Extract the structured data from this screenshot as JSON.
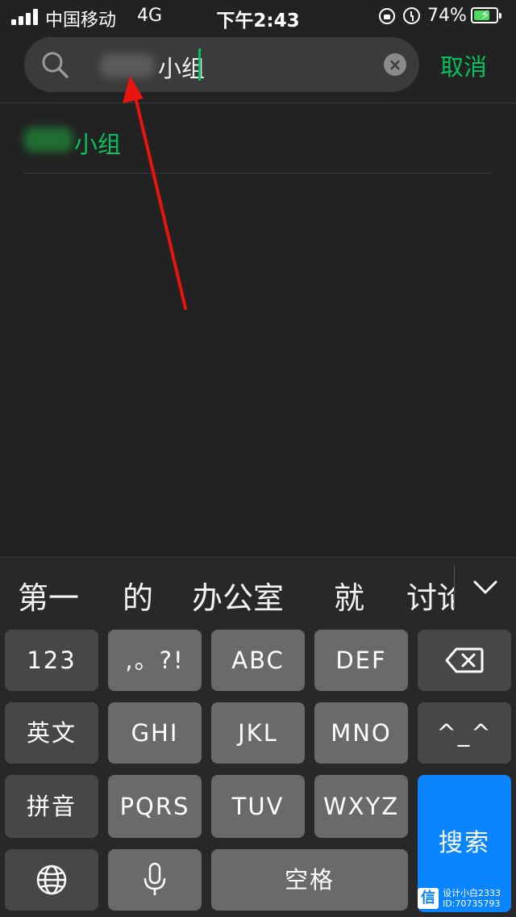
{
  "status_bar": {
    "carrier": "中国移动",
    "network": "4G",
    "time": "下午2:43",
    "battery_percent": "74%",
    "battery_level": 0.74,
    "icons": [
      "signal-icon",
      "orientation-lock-icon",
      "alarm-icon",
      "battery-charging-icon"
    ]
  },
  "search": {
    "query_visible": "小组",
    "cancel_label": "取消",
    "icons": [
      "search-icon",
      "clear-icon"
    ]
  },
  "results": [
    {
      "label": "小组"
    }
  ],
  "keyboard": {
    "candidates": [
      "第一",
      "的",
      "办公室",
      "就",
      "讨论"
    ],
    "rows": [
      [
        "123",
        ",。?!",
        "ABC",
        "DEF",
        "delete-icon"
      ],
      [
        "英文",
        "GHI",
        "JKL",
        "MNO",
        "^_^"
      ],
      [
        "拼音",
        "PQRS",
        "TUV",
        "WXYZ"
      ],
      [
        "globe-icon",
        "microphone-icon",
        "空格"
      ]
    ],
    "labels": {
      "num": "123",
      "punct": ",。?!",
      "abc": "ABC",
      "def": "DEF",
      "english": "英文",
      "ghi": "GHI",
      "jkl": "JKL",
      "mno": "MNO",
      "emoticon": "^_^",
      "pinyin": "拼音",
      "pqrs": "PQRS",
      "tuv": "TUV",
      "wxyz": "WXYZ",
      "space": "空格",
      "search": "搜索"
    },
    "search_color": "#0a84ff"
  },
  "watermark": {
    "logo": "信",
    "line1": "设计小白2333",
    "line2": "ID:70735793"
  },
  "colors": {
    "accent": "#07c160",
    "annotation_arrow": "#e8140d"
  }
}
